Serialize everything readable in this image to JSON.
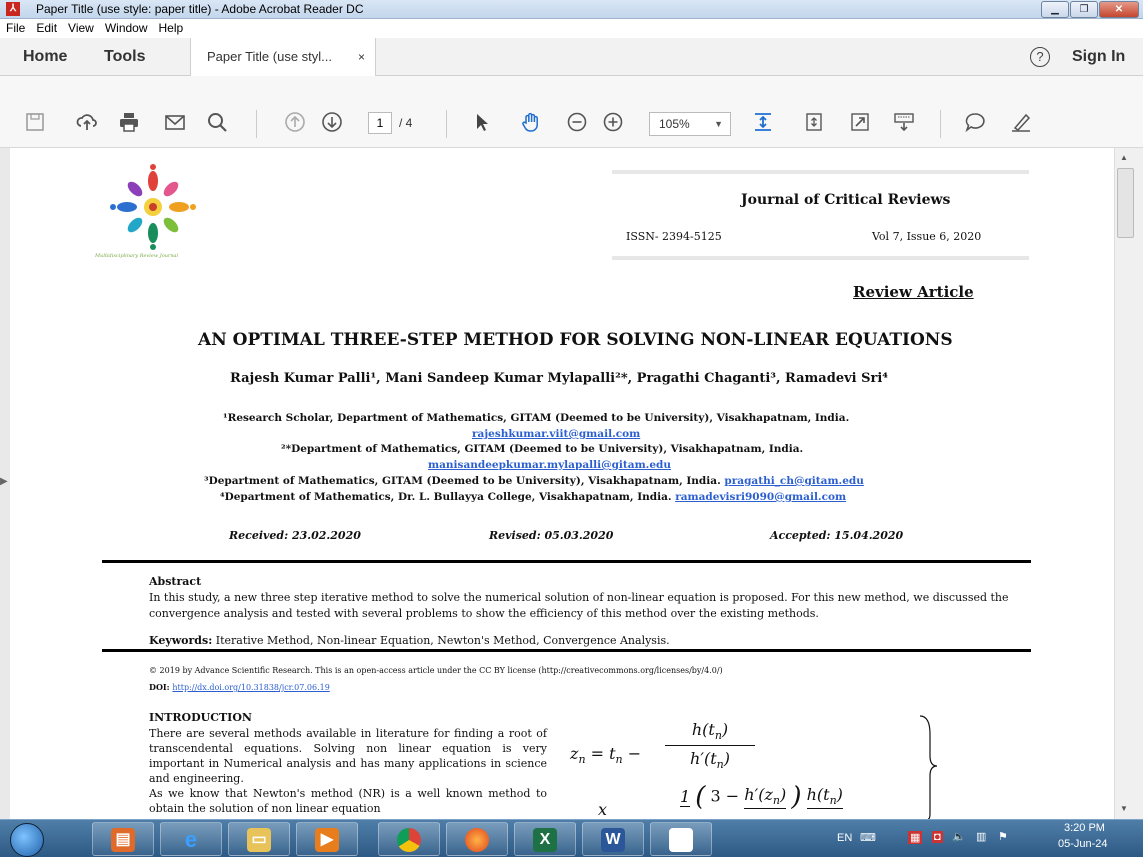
{
  "window": {
    "title": "Paper Title (use style: paper title) - Adobe Acrobat Reader DC",
    "app_icon": "acrobat-icon"
  },
  "menu": [
    "File",
    "Edit",
    "View",
    "Window",
    "Help"
  ],
  "tabs": {
    "home": "Home",
    "tools": "Tools",
    "document_tab": "Paper Title (use styl...",
    "close_glyph": "×",
    "help_glyph": "?",
    "sign_in": "Sign In"
  },
  "toolbar": {
    "page_current": "1",
    "page_total": "/ 4",
    "zoom": "105%",
    "icons": [
      "save-icon",
      "upload-cloud-icon",
      "print-icon",
      "email-icon",
      "search-icon",
      "page-up-icon",
      "page-down-icon",
      "select-arrow-icon",
      "hand-tool-icon",
      "zoom-out-icon",
      "zoom-in-icon",
      "fit-page-icon",
      "scroll-mode-icon",
      "fullscreen-icon",
      "read-mode-icon",
      "comment-icon",
      "sign-pen-icon"
    ]
  },
  "document": {
    "logo_caption": "Multidisciplinary Review Journal",
    "journal_name": "Journal of Critical Reviews",
    "issn": "ISSN- 2394-5125",
    "volume": "Vol 7, Issue 6, 2020",
    "article_type": "Review Article",
    "paper_title": "AN OPTIMAL THREE-STEP METHOD FOR SOLVING NON-LINEAR EQUATIONS",
    "authors": "Rajesh Kumar Palli¹, Mani Sandeep Kumar Mylapalli²*, Pragathi Chaganti³, Ramadevi Sri⁴",
    "affiliation_1": "¹Research Scholar, Department of Mathematics, GITAM (Deemed to be University), Visakhapatnam, India.",
    "email_1": "rajeshkumar.viit@gmail.com",
    "affiliation_2": "²*Department of Mathematics, GITAM (Deemed to be University), Visakhapatnam, India.",
    "email_2": "manisandeepkumar.mylapalli@gitam.edu",
    "affiliation_3": "³Department of Mathematics, GITAM (Deemed to be University), Visakhapatnam, India. ",
    "email_3": "pragathi_ch@gitam.edu",
    "affiliation_4": "⁴Department of Mathematics, Dr. L. Bullayya College, Visakhapatnam, India. ",
    "email_4": "ramadevisri9090@gmail.com",
    "received": "Received: 23.02.2020",
    "revised": "Revised: 05.03.2020",
    "accepted": "Accepted: 15.04.2020",
    "abstract_heading": "Abstract",
    "abstract_text": "In this study, a new three step iterative method to solve the numerical solution of non-linear equation is proposed. For this new method, we discussed the convergence analysis and tested with several problems to show the efficiency of this method over the existing methods.",
    "keywords_label": "Keywords:",
    "keywords_text": " Iterative Method, Non-linear Equation, Newton's Method, Convergence Analysis.",
    "copyright": "© 2019 by Advance Scientific Research. This is an open-access article under the CC BY license (http://creativecommons.org/licenses/by/4.0/)",
    "doi_label": "DOI: ",
    "doi_link": "http://dx.doi.org/10.31838/jcr.07.06.19",
    "intro_heading": "INTRODUCTION",
    "intro_text": "There are several methods available in literature for finding a root of transcendental equations. Solving non linear equation is very important in Numerical analysis and has many applications in science and engineering.",
    "intro_text_2": "As we know that Newton's method (NR) is a well known method to obtain the solution of non linear equation",
    "eq1_lhs": "z",
    "eq1_lhs_sub": "n",
    "eq1_rhs": "= t",
    "eq1_num": "h(t",
    "eq1_den": "h′(t",
    "eq2_lhs": "x",
    "eq2_num": "1",
    "eq2_inner": "3 −",
    "eq2_frac_num": "h′(z",
    "eq2_frac2_num": "h(t"
  },
  "taskbar": {
    "lang": "EN",
    "time": "3:20 PM",
    "date": "05-Jun-24"
  }
}
